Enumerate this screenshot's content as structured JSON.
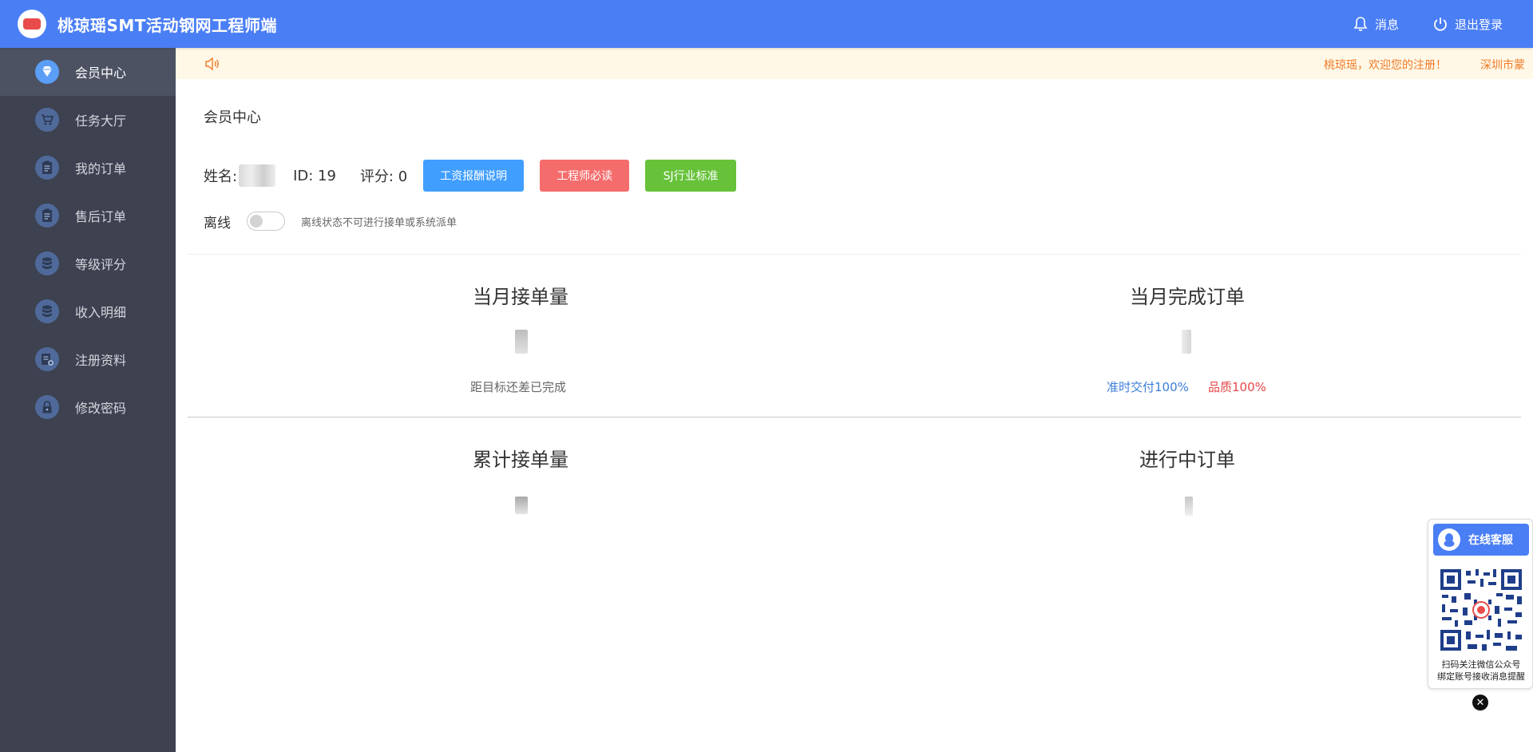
{
  "header": {
    "title": "桃琼瑶SMT活动钢网工程师端",
    "messages_label": "消息",
    "logout_label": "退出登录"
  },
  "sidebar": {
    "items": [
      {
        "label": "会员中心",
        "icon": "diamond-icon",
        "active": true
      },
      {
        "label": "任务大厅",
        "icon": "cart-icon"
      },
      {
        "label": "我的订单",
        "icon": "clipboard-icon"
      },
      {
        "label": "售后订单",
        "icon": "clipboard-icon"
      },
      {
        "label": "等级评分",
        "icon": "database-icon"
      },
      {
        "label": "收入明细",
        "icon": "database-icon"
      },
      {
        "label": "注册资料",
        "icon": "profile-card-icon"
      },
      {
        "label": "修改密码",
        "icon": "lock-icon"
      }
    ]
  },
  "notice": {
    "text": "桃琼瑶，欢迎您的注册！　　　深圳市蒙"
  },
  "main": {
    "page_title": "会员中心",
    "name_label": "姓名:",
    "id_text": "ID: 19",
    "score_text": "评分: 0",
    "buttons": {
      "salary": "工资报酬说明",
      "must_read": "工程师必读",
      "standard": "SJ行业标准"
    },
    "status_label": "离线",
    "status_hint": "离线状态不可进行接单或系统派单",
    "stats": {
      "monthly_received": {
        "title": "当月接单量",
        "footer": "距目标还差已完成"
      },
      "monthly_completed": {
        "title": "当月完成订单",
        "ontime": "准时交付100%",
        "quality": "品质100%"
      },
      "total_received": {
        "title": "累计接单量"
      },
      "in_progress": {
        "title": "进行中订单"
      }
    }
  },
  "float_panel": {
    "service_label": "在线客服",
    "qr_caption_line1": "扫码关注微信公众号",
    "qr_caption_line2": "绑定账号接收消息提醒",
    "close_label": "✕"
  },
  "colors": {
    "header": "#4a7ef5",
    "sidebar": "#3d4150",
    "notice_bg": "#fff8e6",
    "notice_text": "#ef7a28",
    "btn_blue": "#409eff",
    "btn_red": "#f56c6c",
    "btn_green": "#67c23a"
  }
}
